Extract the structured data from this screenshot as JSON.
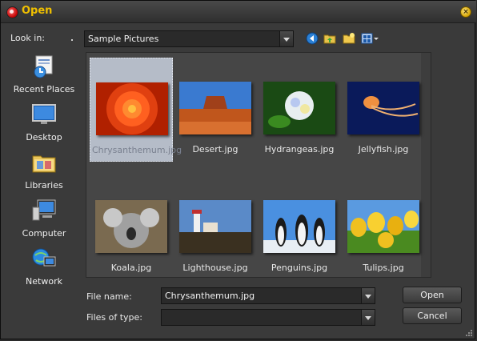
{
  "window": {
    "title": "Open",
    "title_color": "#f0c000"
  },
  "lookin": {
    "label": "Look in:",
    "value": "Sample Pictures"
  },
  "toolbar": {
    "icons": [
      "back-icon",
      "up-folder-icon",
      "new-folder-icon",
      "view-menu-icon"
    ]
  },
  "places": [
    {
      "label": "Recent Places",
      "icon": "recent-places-icon"
    },
    {
      "label": "Desktop",
      "icon": "desktop-icon"
    },
    {
      "label": "Libraries",
      "icon": "libraries-icon"
    },
    {
      "label": "Computer",
      "icon": "computer-icon"
    },
    {
      "label": "Network",
      "icon": "network-icon"
    }
  ],
  "files": [
    {
      "name": "Chrysanthemum.jpg",
      "selected": true
    },
    {
      "name": "Desert.jpg"
    },
    {
      "name": "Hydrangeas.jpg"
    },
    {
      "name": "Jellyfish.jpg"
    },
    {
      "name": "Koala.jpg"
    },
    {
      "name": "Lighthouse.jpg"
    },
    {
      "name": "Penguins.jpg"
    },
    {
      "name": "Tulips.jpg"
    }
  ],
  "form": {
    "filename_label": "File name:",
    "filename_value": "Chrysanthemum.jpg",
    "filetype_label": "Files of type:",
    "filetype_value": ""
  },
  "buttons": {
    "open": "Open",
    "cancel": "Cancel"
  }
}
